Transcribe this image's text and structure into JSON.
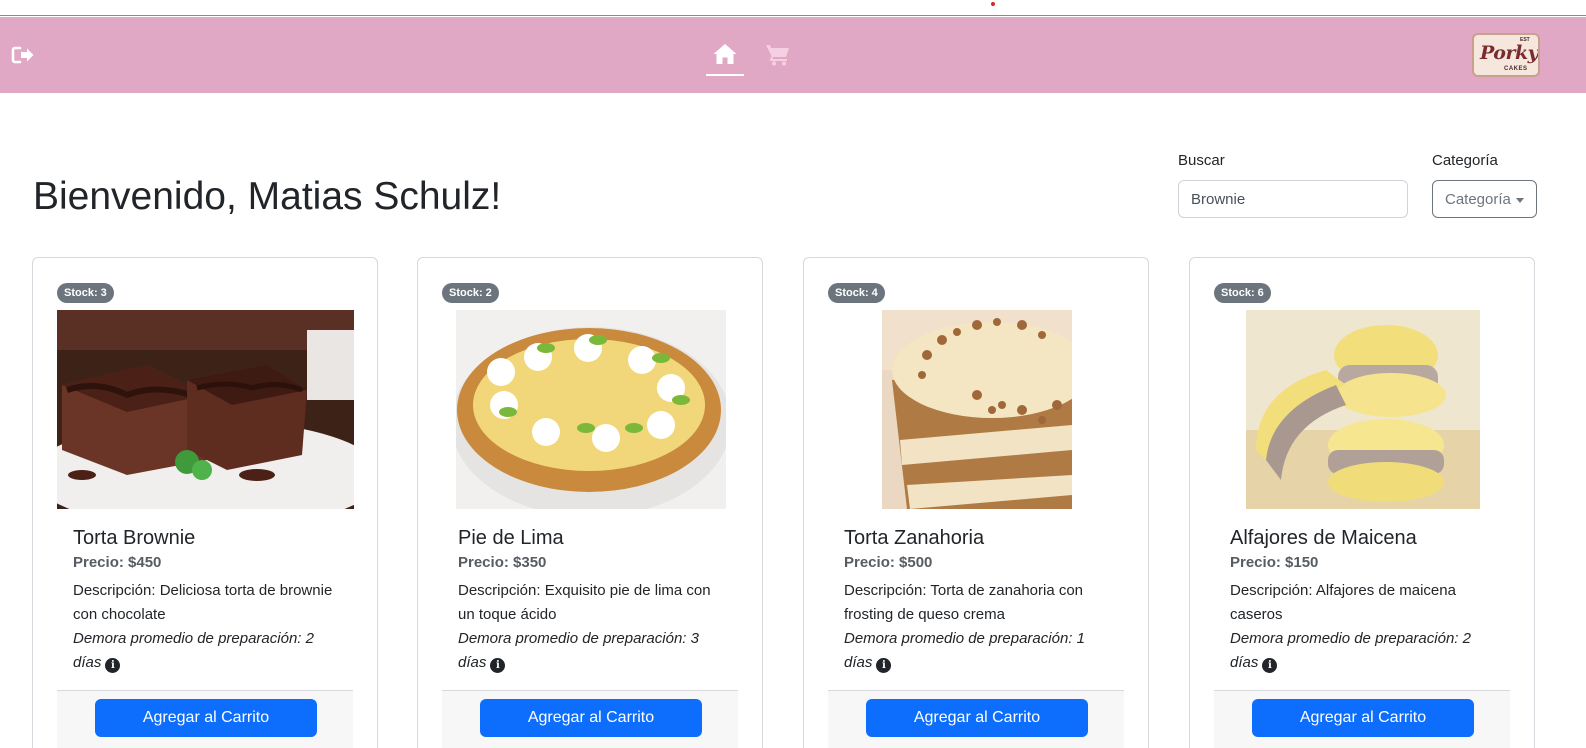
{
  "navbar": {
    "background": "#e1a8c6",
    "logout_icon": "logout-icon",
    "home_icon": "home-icon",
    "cart_icon": "cart-icon",
    "logo": {
      "main": "Porky",
      "sub": "CAKES",
      "est": "EST"
    }
  },
  "header": {
    "welcome": "Bienvenido, Matias Schulz!"
  },
  "filters": {
    "search_label": "Buscar",
    "search_value": "Brownie",
    "category_label": "Categoría",
    "category_selected": "Categoría"
  },
  "products": [
    {
      "stock": "Stock: 3",
      "image": "brownie-photo",
      "title": "Torta Brownie",
      "price": "Precio: $450",
      "description": "Descripción: Deliciosa torta de brownie con chocolate",
      "delay": "Demora promedio de preparación: 2 días",
      "button": "Agregar al Carrito"
    },
    {
      "stock": "Stock: 2",
      "image": "lime-pie-photo",
      "title": "Pie de Lima",
      "price": "Precio: $350",
      "description": "Descripción: Exquisito pie de lima con un toque ácido",
      "delay": "Demora promedio de preparación: 3 días",
      "button": "Agregar al Carrito"
    },
    {
      "stock": "Stock: 4",
      "image": "carrot-cake-photo",
      "title": "Torta Zanahoria",
      "price": "Precio: $500",
      "description": "Descripción: Torta de zanahoria con frosting de queso crema",
      "delay": "Demora promedio de preparación: 1 días",
      "button": "Agregar al Carrito"
    },
    {
      "stock": "Stock: 6",
      "image": "alfajores-photo",
      "title": "Alfajores de Maicena",
      "price": "Precio: $150",
      "description": "Descripción: Alfajores de maicena caseros",
      "delay": "Demora promedio de preparación: 2 días",
      "button": "Agregar al Carrito"
    }
  ],
  "colors": {
    "primary_button": "#0d6efd",
    "badge": "#6c757d"
  }
}
